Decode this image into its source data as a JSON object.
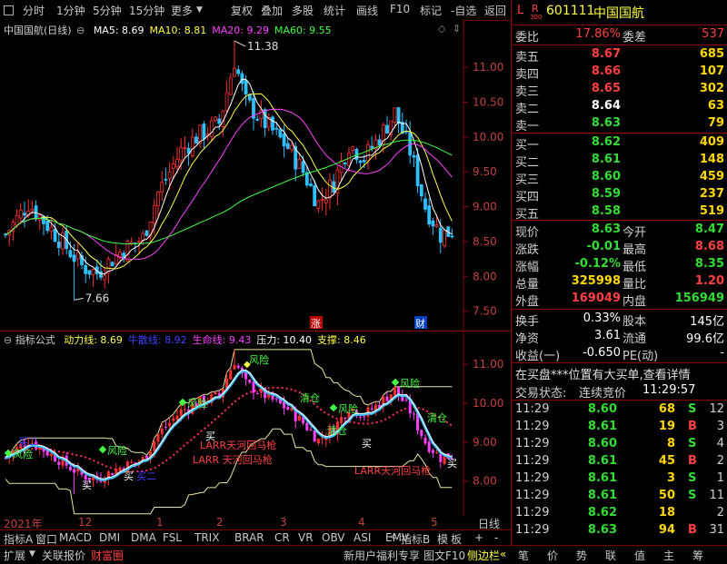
{
  "toolbar": {
    "items": [
      "分时",
      "1分钟",
      "5分钟",
      "15分钟",
      "更多"
    ],
    "right_items": [
      "复权",
      "叠加",
      "多股",
      "统计",
      "画线",
      "F10",
      "标记",
      "-自选",
      "返回"
    ]
  },
  "stock": {
    "badge_l": "L",
    "badge_r": "R",
    "badge_num": "300",
    "code": "601111",
    "name": "中国国航"
  },
  "main_chart": {
    "title": "中国国航(日线)",
    "ma": [
      {
        "label": "MA5: 8.69",
        "color": "#ffffff"
      },
      {
        "label": "MA10: 8.81",
        "color": "#ffff40"
      },
      {
        "label": "MA20: 9.29",
        "color": "#ff40ff"
      },
      {
        "label": "MA60: 9.55",
        "color": "#40ff40"
      }
    ],
    "price_ticks": [
      "11.00",
      "10.50",
      "10.00",
      "9.50",
      "9.00",
      "8.50",
      "8.00",
      "7.50"
    ],
    "high_label": "11.38",
    "low_label": "7.66",
    "marker_zhang": "涨",
    "marker_cai": "财"
  },
  "ind_chart": {
    "title": "指标公式",
    "params": [
      {
        "label": "动力线: 8.69",
        "color": "#ffff40"
      },
      {
        "label": "牛散线: 8.92",
        "color": "#4040ff"
      },
      {
        "label": "生命线: 9.43",
        "color": "#ff40ff"
      },
      {
        "label": "压力: 10.40",
        "color": "#ffffff"
      },
      {
        "label": "支撑: 8.46",
        "color": "#ffff40"
      }
    ],
    "ticks": [
      "11.00",
      "10.00",
      "9.00",
      "8.00"
    ],
    "labels": {
      "risk": "风险",
      "clear": "清仓",
      "buy": "买",
      "hedge": "加仓",
      "larr": "LARR天河回马枪",
      "larr2": "LARR 天河回马枪",
      "buy2": "买二",
      "buy_big": "买一"
    }
  },
  "time_axis": {
    "labels": [
      "2021年",
      "12",
      "1",
      "2",
      "3",
      "4",
      "5"
    ],
    "period": "日线"
  },
  "tabs": [
    "指标A",
    "窗口",
    "MACD",
    "DMI",
    "DMA",
    "FSL",
    "TRIX",
    "BRAR",
    "CR",
    "VR",
    "OBV",
    "ASI",
    "EMV"
  ],
  "tabs_right": [
    "指标B",
    "模",
    "板",
    "+",
    "-"
  ],
  "bottombar": {
    "items": [
      "扩展",
      "关联报价",
      "财富圈"
    ],
    "right": [
      "新用户福利专享",
      "图文F10",
      "侧边栏"
    ],
    "buttons": [
      "笔",
      "价",
      "势",
      "联",
      "值",
      "主",
      "筹"
    ]
  },
  "quote": {
    "weibi_label": "委比",
    "weibi": "17.86%",
    "weicha_label": "委差",
    "weicha": "537",
    "asks": [
      {
        "label": "卖五",
        "price": "8.67",
        "vol": "685"
      },
      {
        "label": "卖四",
        "price": "8.66",
        "vol": "107"
      },
      {
        "label": "卖三",
        "price": "8.65",
        "vol": "302"
      },
      {
        "label": "卖二",
        "price": "8.64",
        "vol": "63"
      },
      {
        "label": "卖一",
        "price": "8.63",
        "vol": "79"
      }
    ],
    "bids": [
      {
        "label": "买一",
        "price": "8.62",
        "vol": "409"
      },
      {
        "label": "买二",
        "price": "8.61",
        "vol": "148"
      },
      {
        "label": "买三",
        "price": "8.60",
        "vol": "459"
      },
      {
        "label": "买四",
        "price": "8.59",
        "vol": "237"
      },
      {
        "label": "买五",
        "price": "8.58",
        "vol": "519"
      }
    ],
    "stats": [
      {
        "l1": "现价",
        "v1": "8.63",
        "c1": "green",
        "l2": "今开",
        "v2": "8.47",
        "c2": "green"
      },
      {
        "l1": "涨跌",
        "v1": "-0.01",
        "c1": "green",
        "l2": "最高",
        "v2": "8.68",
        "c2": "red"
      },
      {
        "l1": "涨幅",
        "v1": "-0.12%",
        "c1": "green",
        "l2": "最低",
        "v2": "8.35",
        "c2": "green"
      },
      {
        "l1": "总量",
        "v1": "325998",
        "c1": "yellow",
        "l2": "量比",
        "v2": "1.20",
        "c2": "red"
      },
      {
        "l1": "外盘",
        "v1": "169049",
        "c1": "red",
        "l2": "内盘",
        "v2": "156949",
        "c2": "green"
      }
    ],
    "stats2": [
      {
        "l1": "换手",
        "v1": "0.33%",
        "l2": "股本",
        "v2": "145亿"
      },
      {
        "l1": "净资",
        "v1": "3.61",
        "l2": "流通",
        "v2": "99.6亿"
      },
      {
        "l1": "收益(一)",
        "v1": "-0.650",
        "l2": "PE(动)",
        "v2": "-"
      }
    ],
    "notice": "在买盘***位置有大买单,查看详情",
    "status_label": "交易状态:",
    "status": "连续竞价",
    "status_time": "11:29:57"
  },
  "ticks": [
    {
      "t": "11:29",
      "p": "8.60",
      "pc": "green",
      "v": "68",
      "vc": "yellow",
      "s": "S",
      "sc": "green",
      "n": "12"
    },
    {
      "t": "11:29",
      "p": "8.61",
      "pc": "green",
      "v": "19",
      "vc": "yellow",
      "s": "B",
      "sc": "red",
      "n": "3"
    },
    {
      "t": "11:29",
      "p": "8.60",
      "pc": "green",
      "v": "8",
      "vc": "yellow",
      "s": "S",
      "sc": "green",
      "n": "4"
    },
    {
      "t": "11:29",
      "p": "8.61",
      "pc": "green",
      "v": "45",
      "vc": "yellow",
      "s": "B",
      "sc": "red",
      "n": "2"
    },
    {
      "t": "11:29",
      "p": "8.61",
      "pc": "green",
      "v": "3",
      "vc": "yellow",
      "s": "S",
      "sc": "green",
      "n": "1"
    },
    {
      "t": "11:29",
      "p": "8.61",
      "pc": "green",
      "v": "50",
      "vc": "yellow",
      "s": "S",
      "sc": "green",
      "n": "11"
    },
    {
      "t": "11:29",
      "p": "8.62",
      "pc": "green",
      "v": "18",
      "vc": "yellow",
      "s": "",
      "sc": "green",
      "n": "2"
    },
    {
      "t": "11:29",
      "p": "8.63",
      "pc": "green",
      "v": "94",
      "vc": "yellow",
      "s": "B",
      "sc": "red",
      "n": "31"
    }
  ]
}
